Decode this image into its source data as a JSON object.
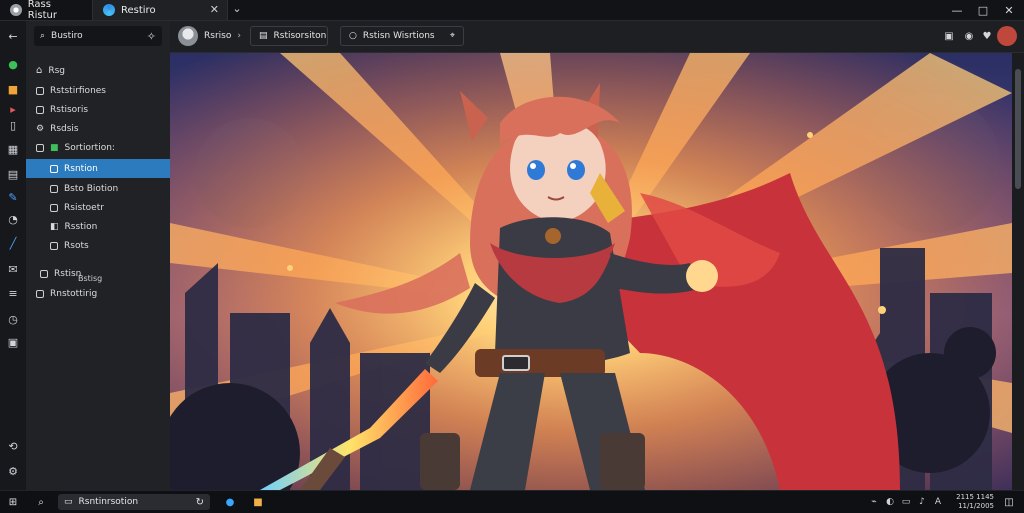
{
  "window": {
    "tabs": [
      {
        "label": "Rass Ristur",
        "icon": "app-icon"
      },
      {
        "label": "Restiro",
        "icon": "edge-icon"
      }
    ],
    "controls": {
      "min": "—",
      "max": "□",
      "close": "✕"
    },
    "tab_dropdown": "⌄"
  },
  "sidebar": {
    "search_label": "Bustiro",
    "items": [
      {
        "label": "Rsg"
      },
      {
        "label": "Rststirfiones"
      },
      {
        "label": "Rstisoris"
      },
      {
        "label": "Rsdsis"
      },
      {
        "label": "Sortiortion:"
      },
      {
        "label": "Rsntion",
        "active": true
      },
      {
        "label": "Bsto Biotion"
      },
      {
        "label": "Rsistoetr"
      },
      {
        "label": "Rsstion"
      },
      {
        "label": "Rsots"
      },
      {
        "label": "Rstisn"
      },
      {
        "label": "Rnstottirig"
      }
    ],
    "sub_label": "Bstisg"
  },
  "toolbar": {
    "profile_label": "Rsriso",
    "work_label": "Rstisorsiton",
    "search_label": "Rstisn Wisrtions"
  },
  "taskbar": {
    "search_text": "Rsntinrsotion",
    "clock_time": "2115 1145",
    "clock_date": "11/1/2005"
  },
  "colors": {
    "accent": "#2c7bbf",
    "cape": "#c8323a",
    "hair": "#d9705c",
    "sky_top": "#2b2f63",
    "burst": "#ffd27a"
  }
}
